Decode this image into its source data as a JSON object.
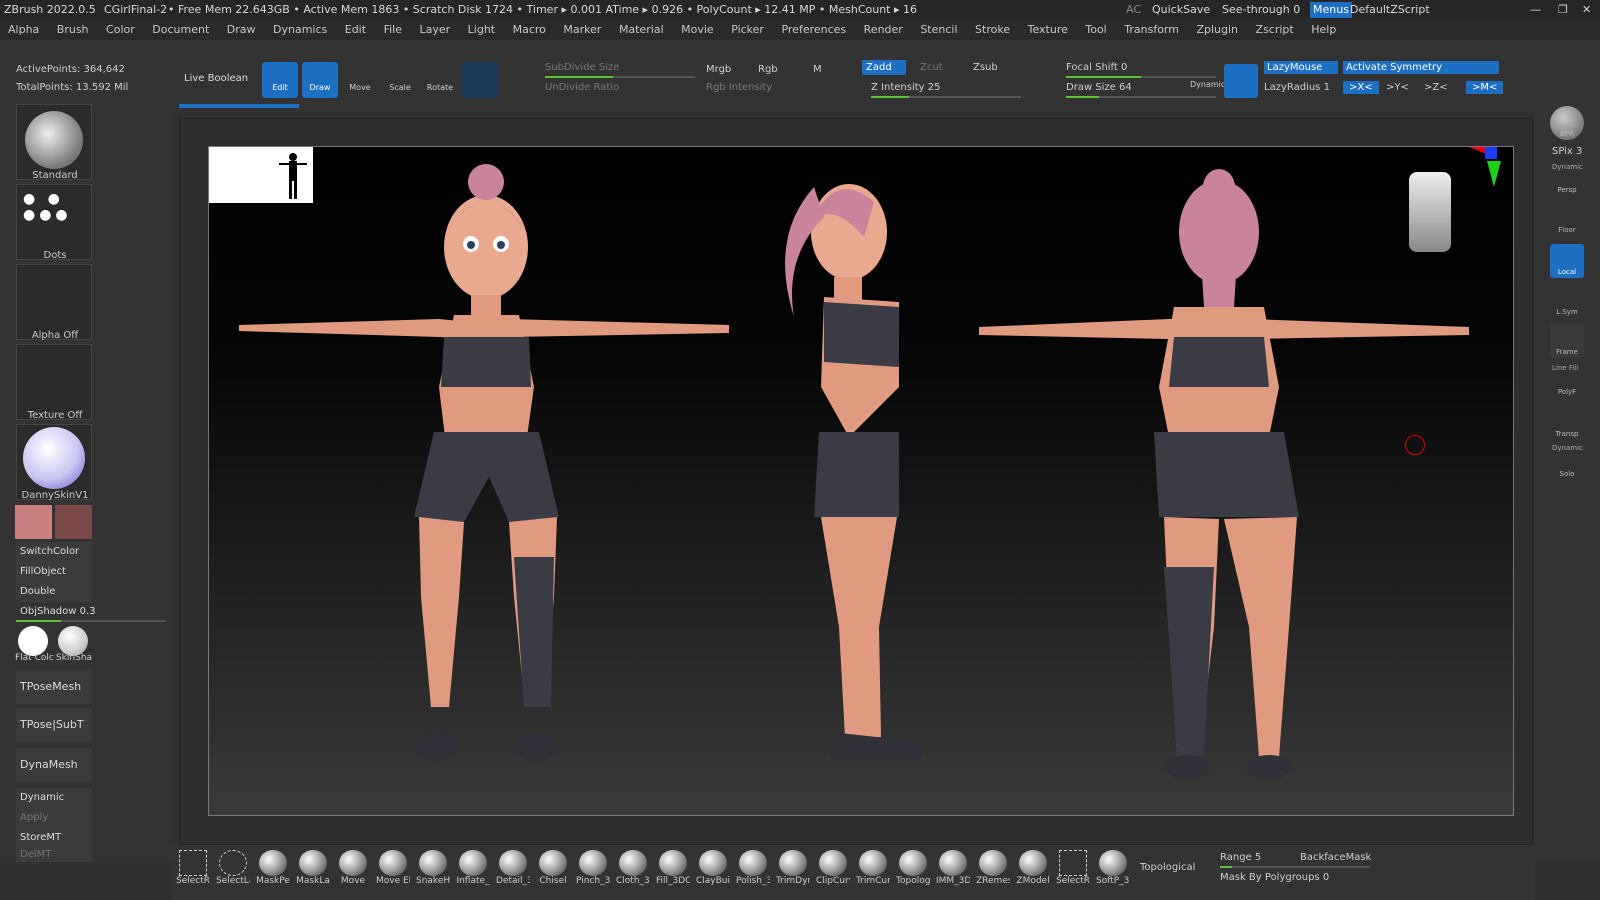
{
  "titlebar": {
    "app": "ZBrush 2022.0.5",
    "doc": "CGirlFinal-2",
    "stats": "• Free Mem 22.643GB • Active Mem 1863 • Scratch Disk 1724 • Timer ▸ 0.001 ATime ▸ 0.926 • PolyCount ▸ 12.41 MP • MeshCount ▸ 16",
    "ac": "AC",
    "quicksave": "QuickSave",
    "seethrough": "See-through 0",
    "menus": "Menus",
    "script": "DefaultZScript"
  },
  "menus": [
    "Alpha",
    "Brush",
    "Color",
    "Document",
    "Draw",
    "Dynamics",
    "Edit",
    "File",
    "Layer",
    "Light",
    "Macro",
    "Marker",
    "Material",
    "Movie",
    "Picker",
    "Preferences",
    "Render",
    "Stencil",
    "Stroke",
    "Texture",
    "Tool",
    "Transform",
    "Zplugin",
    "Zscript",
    "Help"
  ],
  "topshelf": {
    "activepoints": "ActivePoints: 364,642",
    "totalpoints": "TotalPoints: 13.592 Mil",
    "liveboolean": "Live Boolean",
    "edit": "Edit",
    "draw": "Draw",
    "move": "Move",
    "scale": "Scale",
    "rotate": "Rotate",
    "subdivide": "SubDivide Size",
    "undivide": "UnDivide Ratio",
    "mrgb": "Mrgb",
    "rgb": "Rgb",
    "m": "M",
    "rgbint": "Rgb Intensity",
    "zadd": "Zadd",
    "zcut": "Zcut",
    "zsub": "Zsub",
    "zint": "Z Intensity 25",
    "focal": "Focal Shift 0",
    "drawsize": "Draw Size 64",
    "dynamic": "Dynamic",
    "lazymouse": "LazyMouse",
    "lazyradius": "LazyRadius 1",
    "symmetry": "Activate Symmetry",
    "x": ">X<",
    "y": ">Y<",
    "z": ">Z<",
    "mm": ">M<"
  },
  "left": {
    "standard": "Standard",
    "dots": "Dots",
    "alpha": "Alpha Off",
    "texture": "Texture Off",
    "material": "DannySkinV1",
    "switchcolor": "SwitchColor",
    "fillobject": "FillObject",
    "double": "Double",
    "objshadow": "ObjShadow 0.3",
    "flatcolor": "Flat Colc",
    "skinshade": "SkinSha",
    "tposemesh": "TPoseMesh",
    "tposesubt": "TPose|SubT",
    "dynamesh": "DynaMesh",
    "dynamic": "Dynamic",
    "apply": "Apply",
    "storemt": "StoreMT",
    "delmt": "DelMT"
  },
  "right": {
    "bpr": "BPR",
    "spix": "SPix 3",
    "persp": "Persp",
    "floor": "Floor",
    "local": "Local",
    "lsym": "L.Sym",
    "frame": "Frame",
    "linefill": "Line Fill",
    "polyf": "PolyF",
    "transp": "Transp",
    "solo": "Solo",
    "dyn": "Dynamic"
  },
  "bottom": {
    "brushes": [
      "SelectRe",
      "SelectLa",
      "MaskPe",
      "MaskLa",
      "Move",
      "Move El",
      "SnakeHo",
      "Inflate_",
      "Detail_3",
      "Chisel",
      "Pinch_3I",
      "Cloth_3I",
      "Fill_3DC",
      "ClayBuil",
      "Polish_3",
      "TrimDyr",
      "ClipCurv",
      "TrimCur",
      "Topolog",
      "IMM_3D",
      "ZRemes",
      "ZModel",
      "SelectRe",
      "SoftP_3D"
    ],
    "topological": "Topological",
    "range": "Range 5",
    "backface": "BackfaceMask",
    "maskpoly": "Mask By Polygroups 0"
  },
  "colors": {
    "accent": "#1d6fc4",
    "green": "#5bc236",
    "skin": "#e09a80",
    "hair": "#c9839a",
    "cloth": "#3b3b46"
  }
}
